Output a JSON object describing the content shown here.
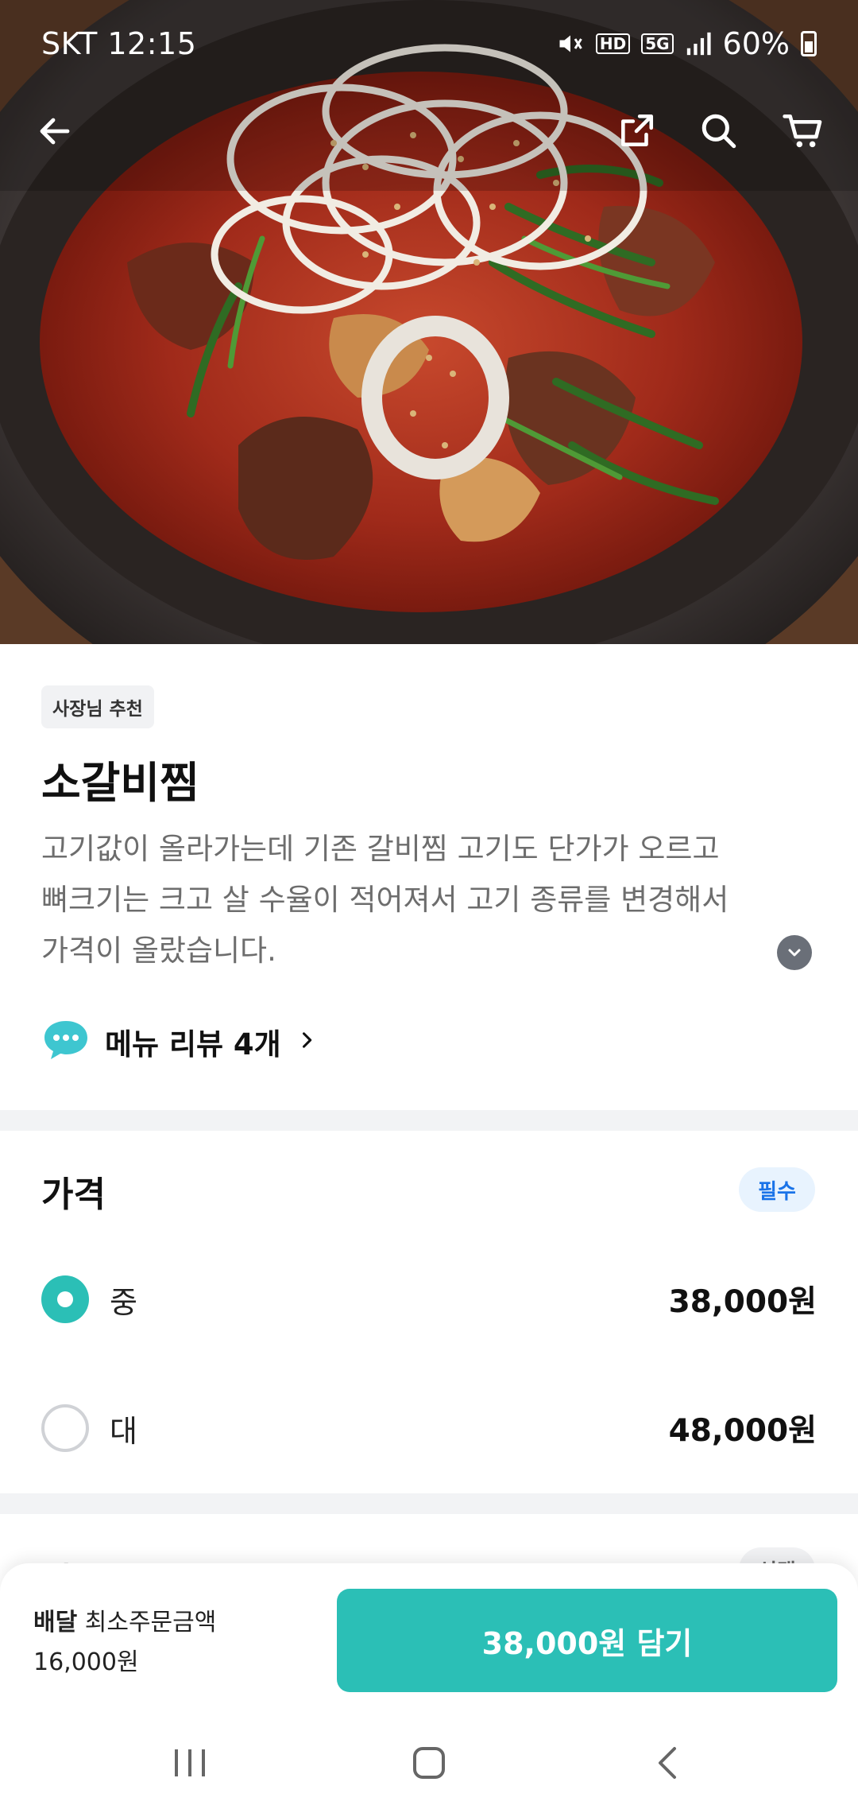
{
  "status_bar": {
    "carrier_time": "SKT 12:15",
    "hd_label": "HD",
    "network_label": "5G",
    "battery": "60%",
    "icons": [
      "mute-icon",
      "hd-voice-icon",
      "5g-icon",
      "signal-icon",
      "battery-icon"
    ]
  },
  "header": {
    "icons": [
      "back-arrow-icon",
      "share-icon",
      "search-icon",
      "cart-icon"
    ]
  },
  "menu": {
    "badge": "사장님 추천",
    "name": "소갈비찜",
    "description_lines": [
      "고기값이 올라가는데 기존 갈비찜 고기도 단가가 오르고",
      "뼈크기는 크고 살 수율이 적어져서 고기 종류를 변경해서",
      "가격이 올랐습니다."
    ],
    "review_link": "메뉴 리뷰 4개"
  },
  "price_section": {
    "title": "가격",
    "required_badge": "필수",
    "options": [
      {
        "label": "중",
        "price": "38,000원",
        "selected": true
      },
      {
        "label": "대",
        "price": "48,000원",
        "selected": false
      }
    ]
  },
  "next_section": {
    "title": "맛 선택",
    "badge": "선택"
  },
  "order_bar": {
    "delivery_label": "배달",
    "min_order_label": "최소주문금액",
    "min_order_amount": "16,000원",
    "add_button": "38,000원 담기"
  },
  "colors": {
    "accent": "#2bbfb6",
    "required_badge_bg": "#e8f3fe",
    "required_badge_text": "#1a73e8"
  }
}
